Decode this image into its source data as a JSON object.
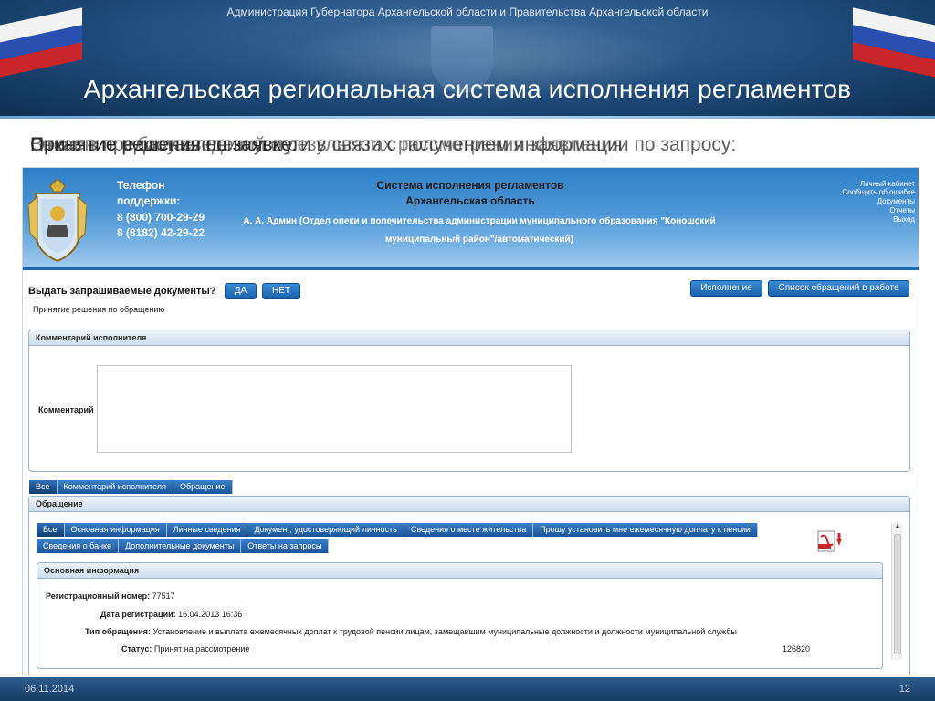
{
  "slide": {
    "subtitle": "Администрация Губернатора Архангельской области и Правительства Архангельской области",
    "title": "Архангельская региональная система исполнения регламентов",
    "captions": [
      "Принятие решения по заявке:",
      "Отказ в предоставлении услуги в связи с получением информации по запросу:",
      "Внесение в базу сведений о результатах рассмотрения заявления"
    ],
    "footer_date": "06.11.2014",
    "page_number": "12"
  },
  "app": {
    "support": {
      "line1": "Телефон",
      "line2": "поддержки:",
      "phone1": "8 (800) 700-29-29",
      "phone2": "8 (8182) 42-29-22"
    },
    "system_title": "Система исполнения регламентов",
    "region_title": "Архангельская область",
    "user_info": "А. А. Админ (Отдел опеки и попечительства администрации муниципального образования \"Коношский муниципальный район\"/автоматический)",
    "top_links": [
      "Личный кабинет",
      "Сообщить об ошибке",
      "Документы",
      "Отчеты",
      "Выход"
    ],
    "decision": {
      "question": "Выдать запрашиваемые документы?",
      "yes_label": "ДА",
      "no_label": "НЕТ",
      "subtitle": "Принятие решения по обращению"
    },
    "execution_button": "Исполнение",
    "list_button": "Список обращений в работе",
    "comment_panel": {
      "title": "Комментарий исполнителя",
      "label": "Комментарий",
      "value": ""
    },
    "outer_tabs": [
      "Все",
      "Комментарий исполнителя",
      "Обращение"
    ],
    "request_panel_title": "Обращение",
    "inner_tabs_row1": [
      "Все",
      "Основная информация",
      "Личные сведения",
      "Документ, удостоверяющий личность",
      "Сведения о месте жительства",
      "Прошу установить мне ежемесячную доплату к пенсии"
    ],
    "inner_tabs_row2": [
      "Сведения о банке",
      "Дополнительные документы",
      "Ответы на запросы"
    ],
    "main_info": {
      "title": "Основная информация",
      "reg_number_label": "Регистрационный номер:",
      "reg_number": "77517",
      "reg_date_label": "Дата регистрации:",
      "reg_date": "16.04.2013 16:36",
      "type_label": "Тип обращения:",
      "type": "Установление и выплата ежемесячных доплат к трудовой пенсии лицам, замещавшим муниципальные должности и должности муниципальной службы",
      "status_label": "Статус:",
      "status": "Принят на рассмотрение",
      "code": "126820"
    },
    "icons": {
      "pdf": "pdf-export-icon",
      "crest": "coat-of-arms-icon"
    }
  }
}
